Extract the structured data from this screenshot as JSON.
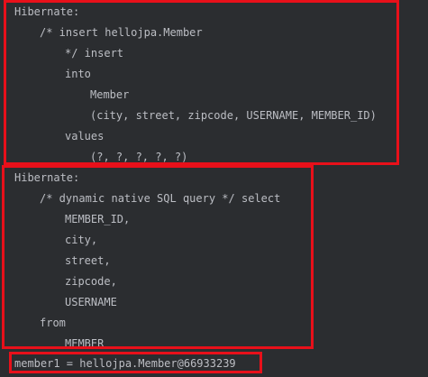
{
  "console": {
    "lines": [
      "Hibernate:",
      "/* insert hellojpa.Member",
      "*/ insert",
      "into",
      "Member",
      "(city, street, zipcode, USERNAME, MEMBER_ID)",
      "values",
      "(?, ?, ?, ?, ?)",
      "Hibernate:",
      "/* dynamic native SQL query */ select",
      "MEMBER_ID,",
      "city,",
      "street,",
      "zipcode,",
      "USERNAME",
      "from",
      "MEMBER",
      "member1 = hellojpa.Member@66933239"
    ]
  },
  "colors": {
    "background": "#2b2d30",
    "text": "#bcbec4",
    "highlight_box": "#e8101a"
  }
}
